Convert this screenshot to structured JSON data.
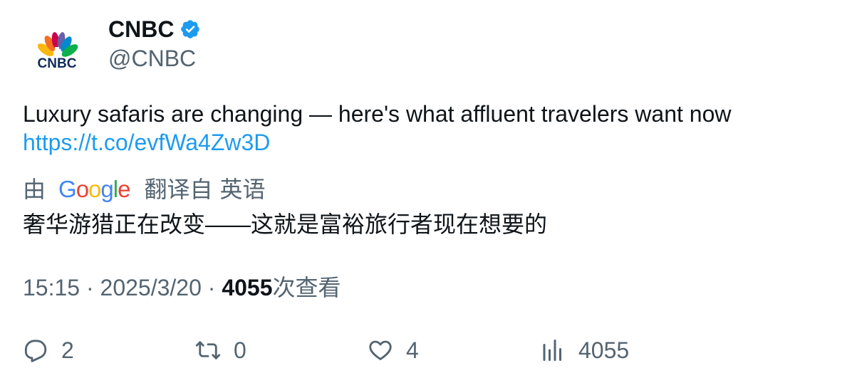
{
  "author": {
    "name": "CNBC",
    "handle": "@CNBC",
    "avatar_icon": "cnbc-peacock-logo",
    "avatar_text": "CNBC",
    "verified_icon": "verified-badge-icon",
    "verified_color": "#1d9bf0"
  },
  "tweet": {
    "text": "Luxury safaris are changing — here's what affluent travelers want now",
    "link": "https://t.co/evfWa4Zw3D",
    "link_color": "#1d9bf0"
  },
  "translation": {
    "prefix": "由",
    "provider": "Google",
    "provider_letters": [
      {
        "char": "G",
        "color": "#4285F4"
      },
      {
        "char": "o",
        "color": "#EA4335"
      },
      {
        "char": "o",
        "color": "#FBBC05"
      },
      {
        "char": "g",
        "color": "#4285F4"
      },
      {
        "char": "l",
        "color": "#34A853"
      },
      {
        "char": "e",
        "color": "#EA4335"
      }
    ],
    "label": "翻译自",
    "language": "英语",
    "text": "奢华游猎正在改变——这就是富裕旅行者现在想要的"
  },
  "meta": {
    "time": "15:15",
    "separator": "·",
    "date": "2025/3/20",
    "views_count": "4055",
    "views_label": "次查看"
  },
  "actions": {
    "reply": {
      "icon": "reply-icon",
      "count": "2"
    },
    "retweet": {
      "icon": "retweet-icon",
      "count": "0"
    },
    "like": {
      "icon": "heart-icon",
      "count": "4"
    },
    "views": {
      "icon": "analytics-icon",
      "count": "4055"
    }
  }
}
